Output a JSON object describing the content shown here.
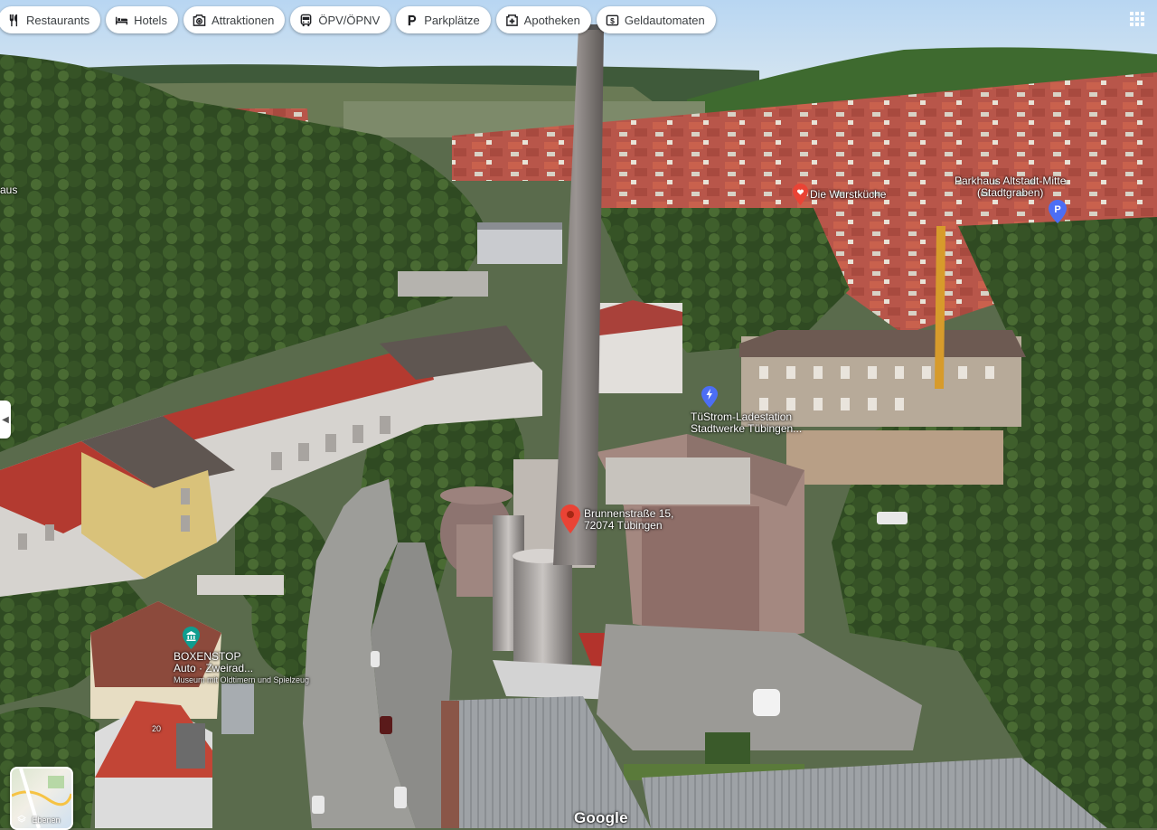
{
  "chips": [
    {
      "label": "Restaurants",
      "icon": "fork-knife-icon"
    },
    {
      "label": "Hotels",
      "icon": "bed-icon"
    },
    {
      "label": "Attraktionen",
      "icon": "camera-icon"
    },
    {
      "label": "ÖPV/ÖPNV",
      "icon": "bus-icon"
    },
    {
      "label": "Parkplätze",
      "icon": "parking-icon"
    },
    {
      "label": "Apotheken",
      "icon": "pharmacy-icon"
    },
    {
      "label": "Geldautomaten",
      "icon": "atm-icon"
    }
  ],
  "places": {
    "wurstkueche": "Die Wurstküche",
    "parkhaus_line1": "Parkhaus Altstadt-Mitte",
    "parkhaus_line2": "(Stadtgraben)",
    "tuestrom_line1": "TüStrom-Ladestation",
    "tuestrom_line2": "Stadtwerke Tübingen...",
    "address_line1": "Brunnenstraße 15,",
    "address_line2": "72074 Tübingen",
    "boxenstop_line1": "BOXENSTOP",
    "boxenstop_line2": "Auto · Zweirad...",
    "boxenstop_sub": "Museum mit Oldtimern und Spielzeug",
    "left_edge": "aus",
    "house_number": "20"
  },
  "layers_label": "Ebenen",
  "brand": "Google",
  "colors": {
    "pin_red": "#ea4335",
    "pin_blue": "#4c6ef5",
    "pin_teal": "#0f9d8f",
    "chip_text": "#3c4043"
  }
}
